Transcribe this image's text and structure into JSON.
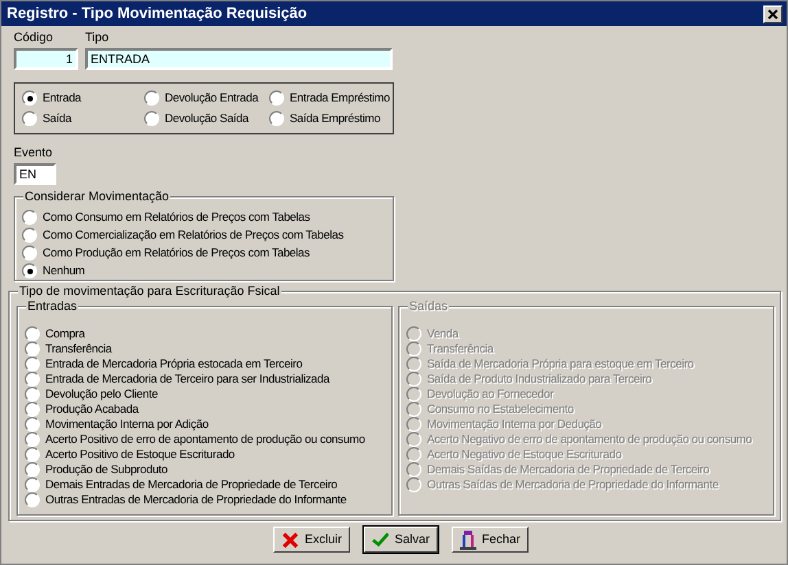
{
  "window": {
    "title": "Registro - Tipo Movimentação Requisição"
  },
  "codigo": {
    "label": "Código",
    "value": "1"
  },
  "tipo": {
    "label": "Tipo",
    "value": "ENTRADA"
  },
  "movement_options": [
    {
      "label": "Entrada",
      "selected": true
    },
    {
      "label": "Devolução Entrada",
      "selected": false
    },
    {
      "label": "Entrada Empréstimo",
      "selected": false
    },
    {
      "label": "Saída",
      "selected": false
    },
    {
      "label": "Devolução Saída",
      "selected": false
    },
    {
      "label": "Saída Empréstimo",
      "selected": false
    }
  ],
  "evento": {
    "label": "Evento",
    "value": "EN"
  },
  "considerar": {
    "title": "Considerar Movimentação",
    "options": [
      {
        "label": "Como Consumo em Relatórios de Preços com Tabelas",
        "selected": false
      },
      {
        "label": "Como Comercialização em Relatórios de Preços com Tabelas",
        "selected": false
      },
      {
        "label": "Como Produção em Relatórios de Preços com Tabelas",
        "selected": false
      },
      {
        "label": "Nenhum",
        "selected": true
      }
    ]
  },
  "escrituracao": {
    "title": "Tipo de movimentação para Escrituração Fsical",
    "groups": [
      {
        "title": "Entradas",
        "disabled": false,
        "options": [
          {
            "label": "Compra",
            "selected": false
          },
          {
            "label": "Transferência",
            "selected": false
          },
          {
            "label": "Entrada de Mercadoria Própria estocada em Terceiro",
            "selected": false
          },
          {
            "label": "Entrada de Mercadoria de Terceiro para ser Industrializada",
            "selected": false
          },
          {
            "label": "Devolução pelo Cliente",
            "selected": false
          },
          {
            "label": "Produção Acabada",
            "selected": false
          },
          {
            "label": "Movimentação Interna por Adição",
            "selected": false
          },
          {
            "label": "Acerto Positivo de erro de apontamento de produção ou consumo",
            "selected": false
          },
          {
            "label": "Acerto Positivo de Estoque Escriturado",
            "selected": false
          },
          {
            "label": "Produção de Subproduto",
            "selected": false
          },
          {
            "label": "Demais Entradas de Mercadoria de Propriedade de Terceiro",
            "selected": false
          },
          {
            "label": "Outras Entradas de Mercadoria de Propriedade do Informante",
            "selected": false
          }
        ]
      },
      {
        "title": "Saídas",
        "disabled": true,
        "options": [
          {
            "label": "Venda",
            "selected": false
          },
          {
            "label": "Transferência",
            "selected": false
          },
          {
            "label": "Saída de Mercadoria Própria para estoque em Terceiro",
            "selected": false
          },
          {
            "label": "Saída de Produto Industrializado para Terceiro",
            "selected": false
          },
          {
            "label": "Devolução ao Fornecedor",
            "selected": false
          },
          {
            "label": "Consumo no Estabelecimento",
            "selected": false
          },
          {
            "label": "Movimentação Interna por Dedução",
            "selected": false
          },
          {
            "label": "Acerto Negativo de erro de apontamento de produção ou consumo",
            "selected": false
          },
          {
            "label": "Acerto Negativo de Estoque Escriturado",
            "selected": false
          },
          {
            "label": "Demais Saídas de Mercadoria de Propriedade de Terceiro",
            "selected": false
          },
          {
            "label": "Outras Saídas de Mercadoria de Propriedade do Informante",
            "selected": false
          }
        ]
      }
    ]
  },
  "buttons": [
    {
      "label": "Excluir",
      "kind": "delete"
    },
    {
      "label": "Salvar",
      "kind": "save"
    },
    {
      "label": "Fechar",
      "kind": "close"
    }
  ]
}
